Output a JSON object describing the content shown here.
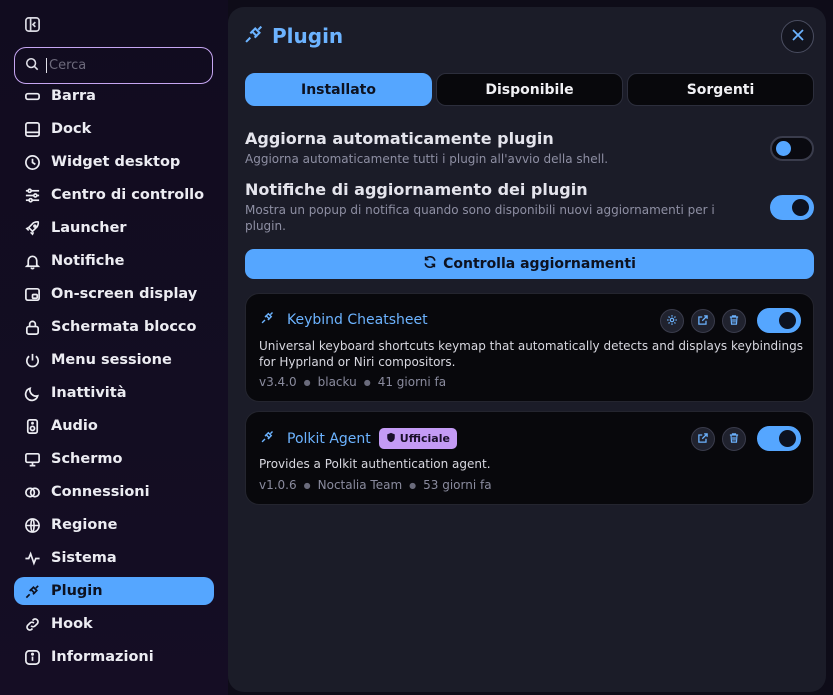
{
  "search": {
    "placeholder": "Cerca"
  },
  "sidebar": {
    "items": [
      {
        "label": "Barra",
        "icon": "bar-icon"
      },
      {
        "label": "Dock",
        "icon": "dock-icon"
      },
      {
        "label": "Widget desktop",
        "icon": "clock-icon"
      },
      {
        "label": "Centro di controllo",
        "icon": "sliders-icon"
      },
      {
        "label": "Launcher",
        "icon": "rocket-icon"
      },
      {
        "label": "Notifiche",
        "icon": "bell-icon"
      },
      {
        "label": "On-screen display",
        "icon": "osd-icon"
      },
      {
        "label": "Schermata blocco",
        "icon": "lock-icon"
      },
      {
        "label": "Menu sessione",
        "icon": "power-icon"
      },
      {
        "label": "Inattività",
        "icon": "moon-icon"
      },
      {
        "label": "Audio",
        "icon": "speaker-icon"
      },
      {
        "label": "Schermo",
        "icon": "monitor-icon"
      },
      {
        "label": "Connessioni",
        "icon": "connections-icon"
      },
      {
        "label": "Regione",
        "icon": "globe-icon"
      },
      {
        "label": "Sistema",
        "icon": "activity-icon"
      },
      {
        "label": "Plugin",
        "icon": "plug-icon",
        "active": true
      },
      {
        "label": "Hook",
        "icon": "link-icon"
      },
      {
        "label": "Informazioni",
        "icon": "info-icon"
      }
    ]
  },
  "panel": {
    "title": "Plugin",
    "tabs": [
      {
        "label": "Installato",
        "active": true
      },
      {
        "label": "Disponibile"
      },
      {
        "label": "Sorgenti"
      }
    ],
    "auto_update": {
      "title": "Aggiorna automaticamente plugin",
      "description": "Aggiorna automaticamente tutti i plugin all'avvio della shell.",
      "enabled": false
    },
    "update_notify": {
      "title": "Notifiche di aggiornamento dei plugin",
      "description": "Mostra un popup di notifica quando sono disponibili nuovi aggiornamenti per i plugin.",
      "enabled": true
    },
    "check_button": "Controlla aggiornamenti"
  },
  "plugins": [
    {
      "name": "Keybind Cheatsheet",
      "description": "Universal keyboard shortcuts keymap that automatically detects and displays keybindings for Hyprland or Niri compositors.",
      "version": "v3.4.0",
      "author": "blacku",
      "updated": "41 giorni fa",
      "enabled": true
    },
    {
      "name": "Polkit Agent",
      "badge": "Ufficiale",
      "description": "Provides a Polkit authentication agent.",
      "version": "v1.0.6",
      "author": "Noctalia Team",
      "updated": "53 giorni fa",
      "enabled": true
    }
  ],
  "colors": {
    "accent": "#55a6ff",
    "search_border": "#c6a6f2",
    "badge": "#c49bf5"
  }
}
